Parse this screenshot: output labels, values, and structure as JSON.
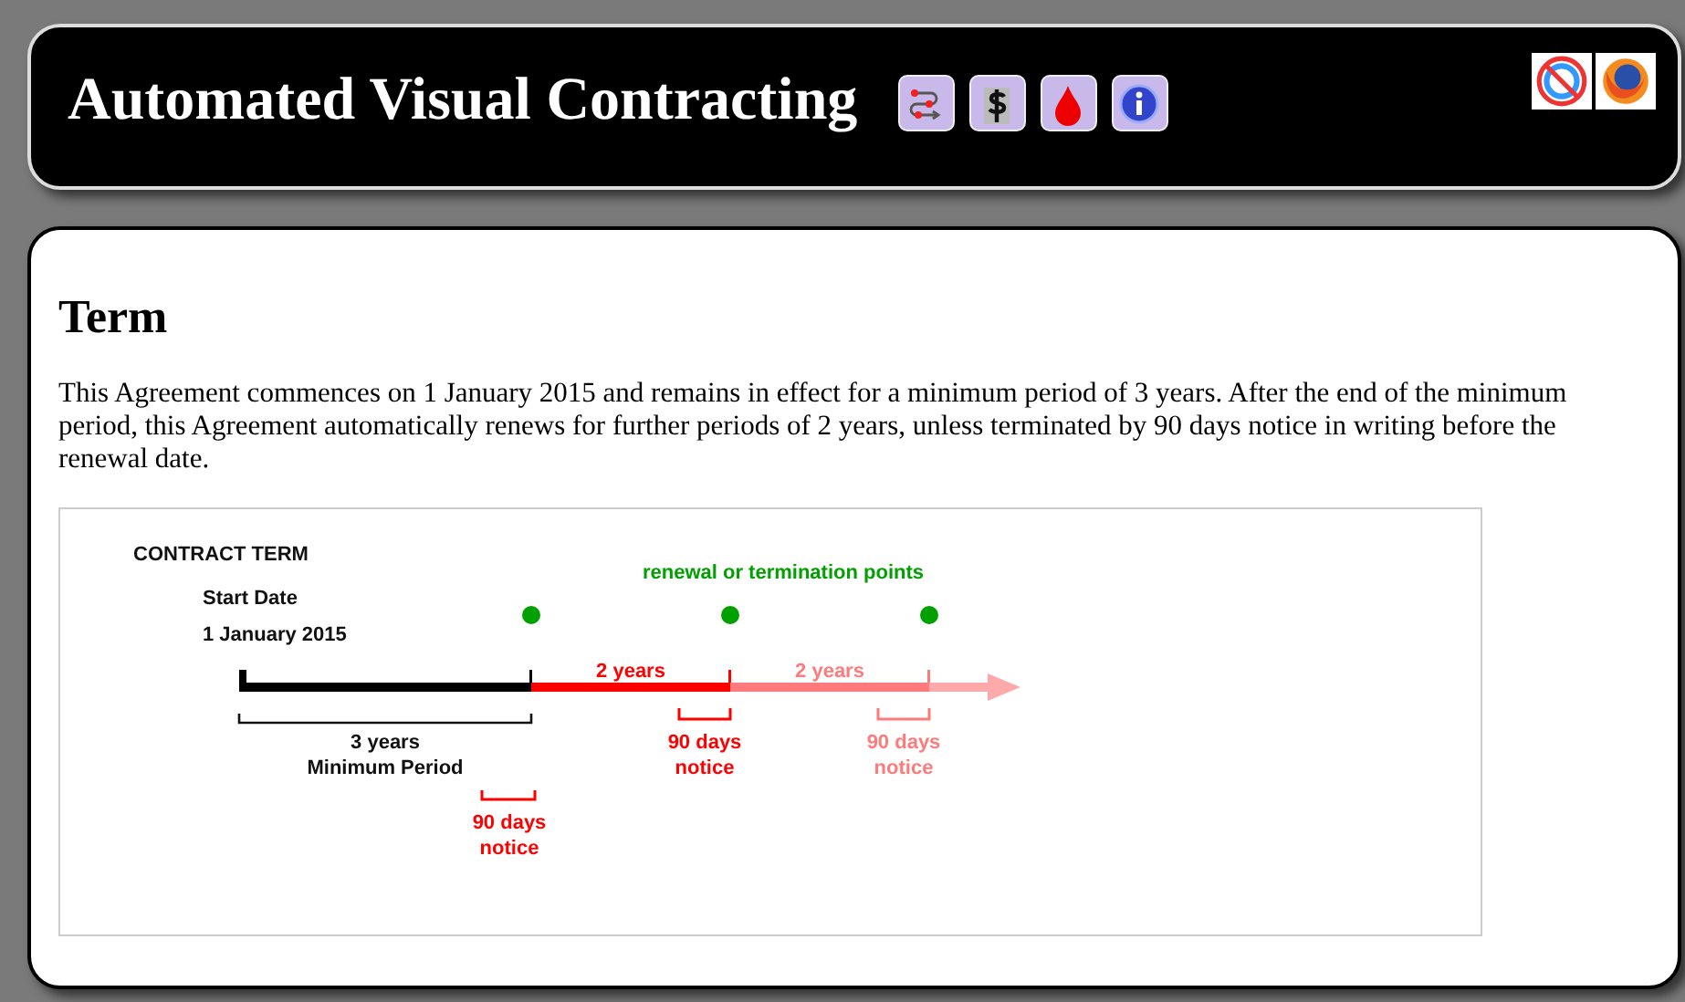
{
  "header": {
    "title": "Automated Visual Contracting",
    "tools": [
      {
        "kind": "flow"
      },
      {
        "kind": "money"
      },
      {
        "kind": "drop"
      },
      {
        "kind": "info"
      }
    ],
    "badges": [
      {
        "kind": "no-ie"
      },
      {
        "kind": "firefox"
      }
    ]
  },
  "section": {
    "heading": "Term",
    "paragraph": "This Agreement commences on 1 January 2015 and remains in effect for a minimum period of 3 years. After the end of the minimum period, this Agreement automatically renews for further periods of 2 years, unless terminated by 90 days notice in writing before the renewal date."
  },
  "diagram": {
    "title": "CONTRACT TERM",
    "start_label": "Start Date",
    "start_date": "1 January 2015",
    "points_label": "renewal or termination points",
    "segments": [
      {
        "kind": "minimum",
        "color": "#000000",
        "label": "3 years",
        "sublabel": "Minimum Period",
        "notice": [
          "90 days",
          "notice"
        ]
      },
      {
        "kind": "renewal",
        "color": "#ff0000",
        "label": "2 years",
        "notice": [
          "90 days",
          "notice"
        ]
      },
      {
        "kind": "renewal",
        "color": "#ff7b7b",
        "label": "2 years",
        "notice": [
          "90 days",
          "notice"
        ]
      }
    ]
  }
}
